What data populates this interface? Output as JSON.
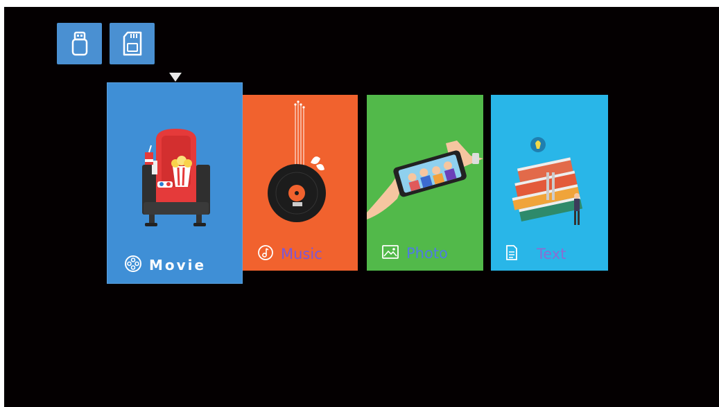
{
  "sources": [
    {
      "name": "usb",
      "icon": "usb-drive-icon"
    },
    {
      "name": "sd",
      "icon": "sd-card-icon"
    }
  ],
  "selected_indicator": "down-triangle-icon",
  "menu": {
    "items": [
      {
        "label": "Movie",
        "icon": "film-reel-icon",
        "selected": true,
        "color": "#3f8fd6"
      },
      {
        "label": "Music",
        "icon": "music-note-icon",
        "selected": false,
        "color": "#f1622e"
      },
      {
        "label": "Photo",
        "icon": "image-icon",
        "selected": false,
        "color": "#52b94a"
      },
      {
        "label": "Text",
        "icon": "document-icon",
        "selected": false,
        "color": "#29b6e8"
      }
    ]
  },
  "colors": {
    "background": "#040001",
    "source_button": "#4a90d2"
  }
}
